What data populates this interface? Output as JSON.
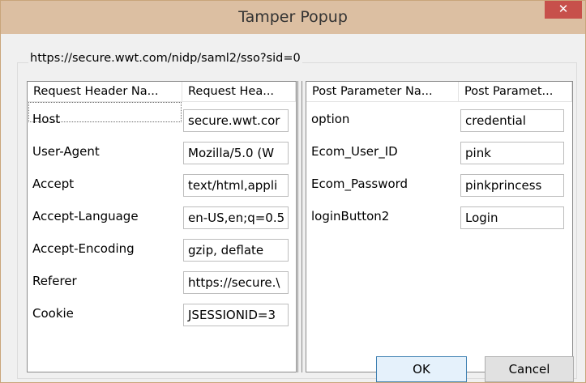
{
  "window": {
    "title": "Tamper Popup",
    "close_glyph": "✕"
  },
  "url": "https://secure.wwt.com/nidp/saml2/sso?sid=0",
  "request_headers": {
    "columns": [
      "Request Header Na...",
      "Request Hea..."
    ],
    "rows": [
      {
        "name": "Host",
        "value": "secure.wwt.cor"
      },
      {
        "name": "User-Agent",
        "value": "Mozilla/5.0 (W"
      },
      {
        "name": "Accept",
        "value": "text/html,appli"
      },
      {
        "name": "Accept-Language",
        "value": "en-US,en;q=0.5"
      },
      {
        "name": "Accept-Encoding",
        "value": "gzip, deflate"
      },
      {
        "name": "Referer",
        "value": "https://secure.\\"
      },
      {
        "name": "Cookie",
        "value": "JSESSIONID=3"
      }
    ]
  },
  "post_params": {
    "columns": [
      "Post Parameter Na...",
      "Post Paramet..."
    ],
    "rows": [
      {
        "name": "option",
        "value": "credential"
      },
      {
        "name": "Ecom_User_ID",
        "value": "pink"
      },
      {
        "name": "Ecom_Password",
        "value": "pinkprincess"
      },
      {
        "name": "loginButton2",
        "value": "Login"
      }
    ]
  },
  "buttons": {
    "ok": "OK",
    "cancel": "Cancel"
  },
  "colors": {
    "titlebar": "#dcbfa2",
    "close": "#c7504b",
    "window_border": "#c9a57a"
  }
}
